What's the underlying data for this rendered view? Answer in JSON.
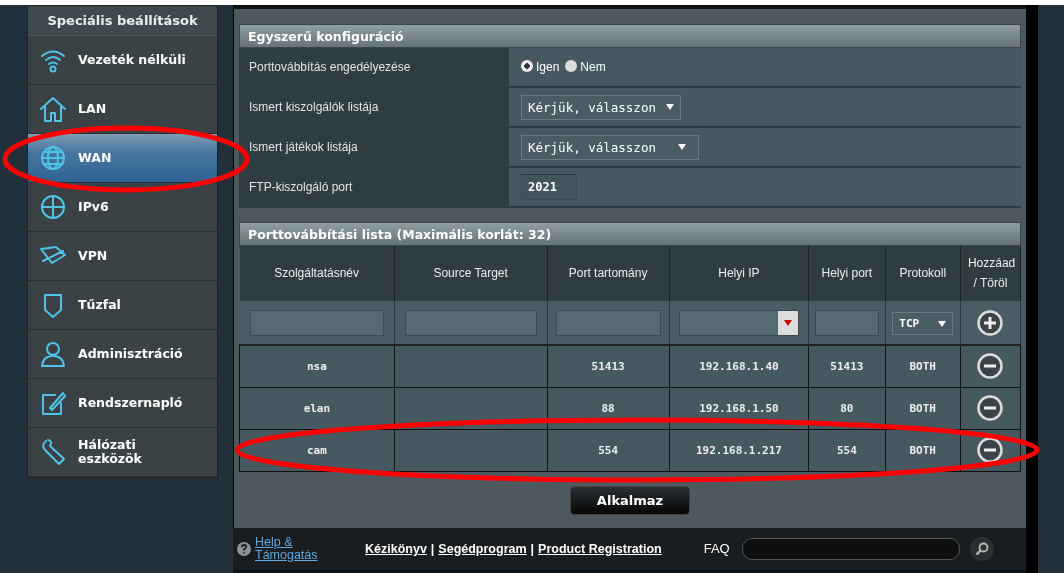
{
  "sidebar": {
    "title": "Speciális beállítások",
    "items": [
      {
        "kind": "wifi",
        "label": "Vezeték nélküli",
        "selected": false,
        "highlighted": false
      },
      {
        "kind": "home",
        "label": "LAN",
        "selected": false,
        "highlighted": false
      },
      {
        "kind": "globe",
        "label": "WAN",
        "selected": true,
        "highlighted": true
      },
      {
        "kind": "ipv6",
        "label": "IPv6",
        "selected": false,
        "highlighted": false
      },
      {
        "kind": "vpn",
        "label": "VPN",
        "selected": false,
        "highlighted": false
      },
      {
        "kind": "shield",
        "label": "Tűzfal",
        "selected": false,
        "highlighted": false
      },
      {
        "kind": "user",
        "label": "Adminisztráció",
        "selected": false,
        "highlighted": false
      },
      {
        "kind": "log",
        "label": "Rendszernapló",
        "selected": false,
        "highlighted": false
      },
      {
        "kind": "tools",
        "label": "Hálózati eszközök",
        "selected": false,
        "highlighted": false
      }
    ]
  },
  "basic_config": {
    "title": "Egyszerű konfiguráció",
    "rows": [
      {
        "kind": "radio",
        "label": "Porttovábbítás engedélyezése",
        "options": [
          {
            "label": "Igen",
            "selected": true
          },
          {
            "label": "Nem",
            "selected": false
          }
        ]
      },
      {
        "kind": "select",
        "label": "Ismert kiszolgálók listája",
        "value": "Kérjük, válasszon"
      },
      {
        "kind": "select",
        "label": "Ismert játékok listája",
        "value": "Kérjük, válasszon"
      },
      {
        "kind": "text",
        "label": "FTP-kiszolgáló port",
        "value": "2021"
      }
    ]
  },
  "forward_list": {
    "title": "Porttovábbítási lista (Maximális korlát: 32)",
    "columns": [
      "Szolgáltatásnév",
      "Source Target",
      "Port tartomány",
      "Helyi IP",
      "Helyi port",
      "Protokoll",
      "Hozzáad / Töröl"
    ],
    "input_row": [
      {
        "kind": "text"
      },
      {
        "kind": "text"
      },
      {
        "kind": "text"
      },
      {
        "kind": "combo"
      },
      {
        "kind": "text"
      },
      {
        "kind": "select",
        "value": "TCP"
      },
      {
        "kind": "add"
      }
    ],
    "rows": [
      {
        "cells": [
          "nsa",
          "",
          "51413",
          "192.168.1.40",
          "51413",
          "BOTH"
        ],
        "highlighted": false
      },
      {
        "cells": [
          "elan",
          "",
          "88",
          "192.168.1.50",
          "80",
          "BOTH"
        ],
        "highlighted": false
      },
      {
        "cells": [
          "cam",
          "",
          "554",
          "192.168.1.217",
          "554",
          "BOTH"
        ],
        "highlighted": true
      }
    ]
  },
  "apply_button": "Alkalmaz",
  "footer": {
    "help": "Help & Támogatás",
    "links": [
      "Kézikönyv",
      "Segédprogram",
      "Product Registration"
    ],
    "separator": "|",
    "faq": "FAQ"
  }
}
